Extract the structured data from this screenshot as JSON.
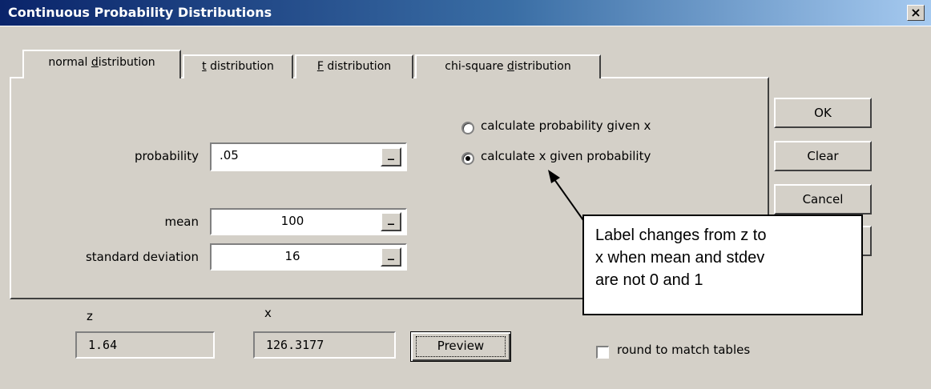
{
  "window": {
    "title": "Continuous Probability Distributions",
    "close_glyph": "×"
  },
  "tabs": [
    {
      "label_pre": "normal ",
      "label_key": "d",
      "label_post": "istribution"
    },
    {
      "label_pre": "",
      "label_key": "t",
      "label_post": " distribution"
    },
    {
      "label_pre": "",
      "label_key": "F",
      "label_post": " distribution"
    },
    {
      "label_pre": "chi-square ",
      "label_key": "d",
      "label_post": "istribution"
    }
  ],
  "form": {
    "probability_label": "probability",
    "probability_value": ".05",
    "mean_label": "mean",
    "mean_value": "100",
    "sd_label": "standard deviation",
    "sd_value": "16",
    "mini_button_glyph": "_"
  },
  "mode": {
    "option1": "calculate probability given x",
    "option2": "calculate x given probability",
    "selected": "option2"
  },
  "buttons": {
    "ok": "OK",
    "clear": "Clear",
    "cancel": "Cancel",
    "preview": "Preview"
  },
  "results": {
    "z_label": "z",
    "z_value": "1.64",
    "x_label": "x",
    "x_value": "126.3177"
  },
  "round_option": {
    "label": "round to match tables",
    "checked": false
  },
  "annotation": {
    "text_line1": "Label changes from z to",
    "text_line2": "x when mean and stdev",
    "text_line3": "are not 0 and 1"
  }
}
